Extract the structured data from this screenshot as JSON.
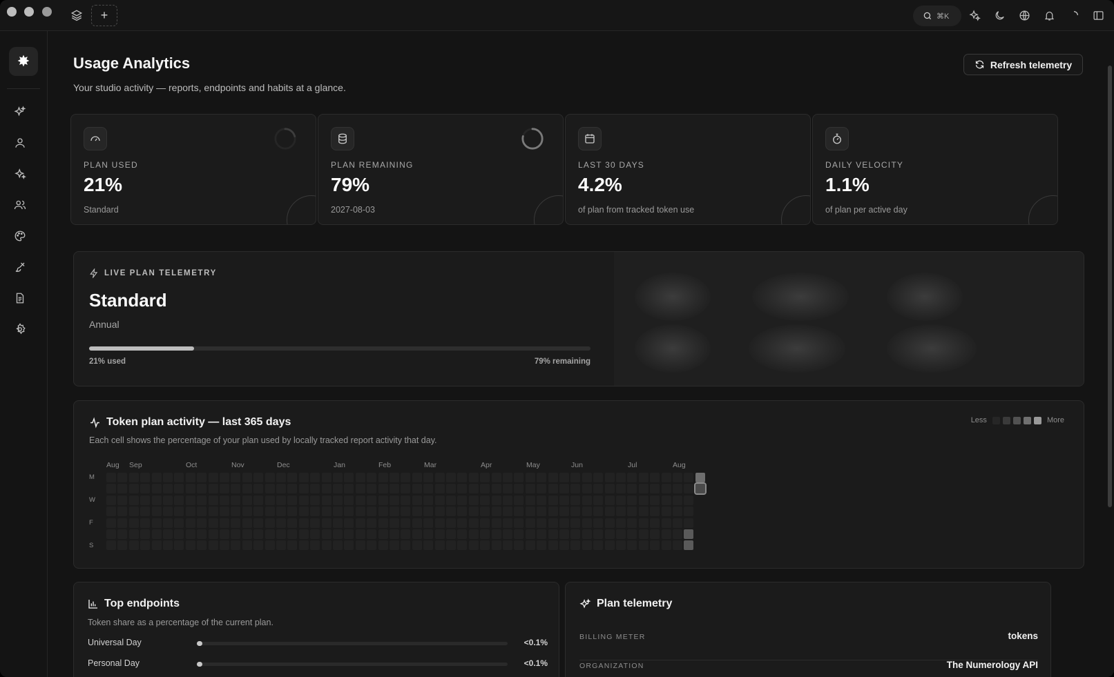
{
  "titlebar": {
    "search_shortcut": "⌘K"
  },
  "page": {
    "title": "Usage Analytics",
    "subtitle": "Your studio activity — reports, endpoints and habits at a glance.",
    "refresh_label": "Refresh telemetry"
  },
  "stats": [
    {
      "label": "PLAN USED",
      "value": "21%",
      "note": "Standard",
      "icon": "gauge-icon"
    },
    {
      "label": "PLAN REMAINING",
      "value": "79%",
      "note": "2027-08-03",
      "icon": "database-icon"
    },
    {
      "label": "LAST 30 DAYS",
      "value": "4.2%",
      "note": "of plan from tracked token use",
      "icon": "calendar-icon"
    },
    {
      "label": "DAILY VELOCITY",
      "value": "1.1%",
      "note": "of plan per active day",
      "icon": "stopwatch-icon"
    }
  ],
  "live": {
    "kicker": "LIVE PLAN TELEMETRY",
    "plan": "Standard",
    "cycle": "Annual",
    "used_fraction": 0.21,
    "used_label": "21% used",
    "remaining_label": "79% remaining"
  },
  "heatmap": {
    "title": "Token plan activity — last 365 days",
    "subtitle": "Each cell shows the percentage of your plan used by locally tracked report activity that day.",
    "legend_less": "Less",
    "legend_more": "More",
    "months": [
      "Aug",
      "Sep",
      "Oct",
      "Nov",
      "Dec",
      "Jan",
      "Feb",
      "Mar",
      "Apr",
      "May",
      "Jun",
      "Jul",
      "Aug"
    ],
    "day_labels": [
      "M",
      "W",
      "F",
      "S"
    ],
    "colors": [
      "#262626",
      "#333333",
      "#4a4a4a",
      "#6a6a6a",
      "#8c8c8c"
    ]
  },
  "endpoints": {
    "title": "Top endpoints",
    "subtitle": "Token share as a percentage of the current plan.",
    "items": [
      {
        "name": "Universal Day",
        "value": "<0.1%"
      },
      {
        "name": "Personal Day",
        "value": "<0.1%"
      }
    ]
  },
  "telemetry": {
    "title": "Plan telemetry",
    "rows": [
      {
        "key": "BILLING METER",
        "value": "tokens"
      },
      {
        "key": "ORGANIZATION",
        "value": "The Numerology API"
      }
    ]
  },
  "sidebar": {
    "items": [
      "sparkles-icon",
      "user-icon",
      "sparkle-star-icon",
      "users-icon",
      "palette-icon",
      "brush-icon",
      "document-icon",
      "settings-icon"
    ]
  }
}
